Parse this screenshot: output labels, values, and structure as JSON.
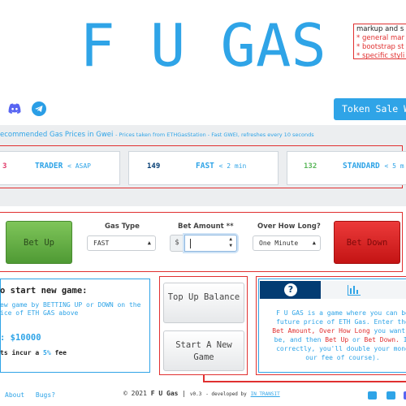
{
  "header": {
    "title": "F U GAS",
    "notes": [
      "markup and s",
      "* general mar",
      "* bootstrap st",
      "* specific styli"
    ],
    "token_sale_label": "Token Sale Wh"
  },
  "social_top": {
    "icons": [
      "discord-icon",
      "telegram-icon"
    ]
  },
  "recommended": {
    "heading": "ecommended Gas Prices in Gwei",
    "subheading": "- Prices taken from ETHGasStation - Fast GWEI, refreshes every 10 seconds",
    "cards": [
      {
        "value": "3",
        "label": "TRADER",
        "hint": "< ASAP",
        "color": "#e03a6a"
      },
      {
        "value": "149",
        "label": "FAST",
        "hint": "< 2 min",
        "color": "#033c73"
      },
      {
        "value": "132",
        "label": "STANDARD",
        "hint": "< 5 m",
        "color": "#5cb85c"
      }
    ]
  },
  "game": {
    "bet_up_label": "Bet Up",
    "bet_down_label": "Bet Down",
    "gas_type_label": "Gas Type",
    "gas_type_value": "FAST",
    "bet_amount_label": "Bet Amount **",
    "currency_symbol": "$",
    "bet_amount_value": "",
    "duration_label": "Over How Long?",
    "duration_value": "One Minute"
  },
  "start_panel": {
    "heading": "o start new game:",
    "text": "ew game by BETTING UP or DOWN on the ice of ETH GAS above",
    "balance": ": $10000",
    "fee_prefix": "ts incur a",
    "fee_pct": "5%",
    "fee_suffix": "fee"
  },
  "actions": {
    "top_up_label": "Top Up Balance",
    "new_game_label": "Start A New Game"
  },
  "info": {
    "p1": "F U GAS is a game where you can be",
    "p2": "future price of ETH Gas. Enter the",
    "bet_amount": "Bet Amount,",
    "over_how_long": "Over How Long",
    "p3": "you want t",
    "p4": "be, and then",
    "bet_up": "Bet Up",
    "or": "or",
    "bet_down": "Bet Down.",
    "p5": "If",
    "p6": "correctly, you'll double your mone",
    "p7": "our fee of course)."
  },
  "footer": {
    "links": [
      "About",
      "Bugs?"
    ],
    "copyright": "© 2021",
    "brand": "F U Gas",
    "version": "v0.3",
    "dev_prefix": "- developed by",
    "dev_name": "IN_TRANSIT"
  },
  "colors": {
    "accent": "#2fa4e7",
    "dark_blue": "#033c73",
    "red": "#e03030",
    "green": "#5cb85c"
  }
}
